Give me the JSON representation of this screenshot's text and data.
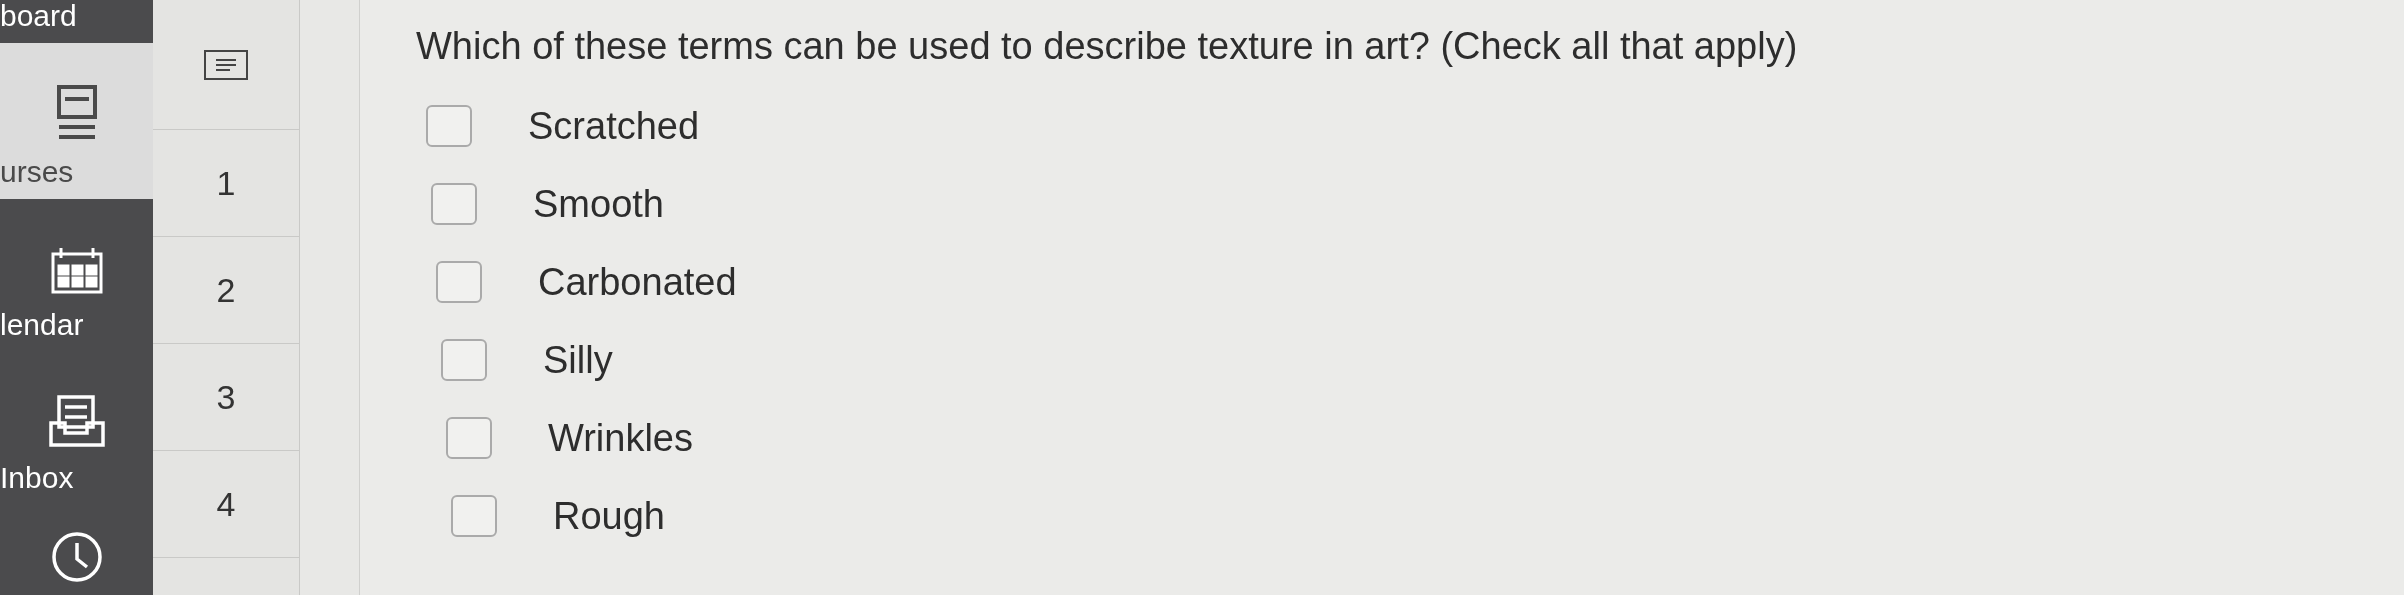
{
  "sidebar": {
    "items": [
      {
        "label": "board",
        "kind": "plain",
        "selected": false
      },
      {
        "label": "urses",
        "kind": "book",
        "selected": true
      },
      {
        "label": "lendar",
        "kind": "calendar",
        "selected": false
      },
      {
        "label": "Inbox",
        "kind": "inbox",
        "selected": false
      },
      {
        "kind": "clock",
        "selected": false
      }
    ]
  },
  "question_nav": {
    "items": [
      {
        "label": "1"
      },
      {
        "label": "2"
      },
      {
        "label": "3"
      },
      {
        "label": "4"
      }
    ]
  },
  "question": {
    "text": "Which of these terms can be used to describe texture in art? (Check all that apply)",
    "options": [
      {
        "label": "Scratched",
        "checked": false
      },
      {
        "label": "Smooth",
        "checked": false
      },
      {
        "label": "Carbonated",
        "checked": false
      },
      {
        "label": "Silly",
        "checked": false
      },
      {
        "label": "Wrinkles",
        "checked": false
      },
      {
        "label": "Rough",
        "checked": false
      }
    ]
  }
}
